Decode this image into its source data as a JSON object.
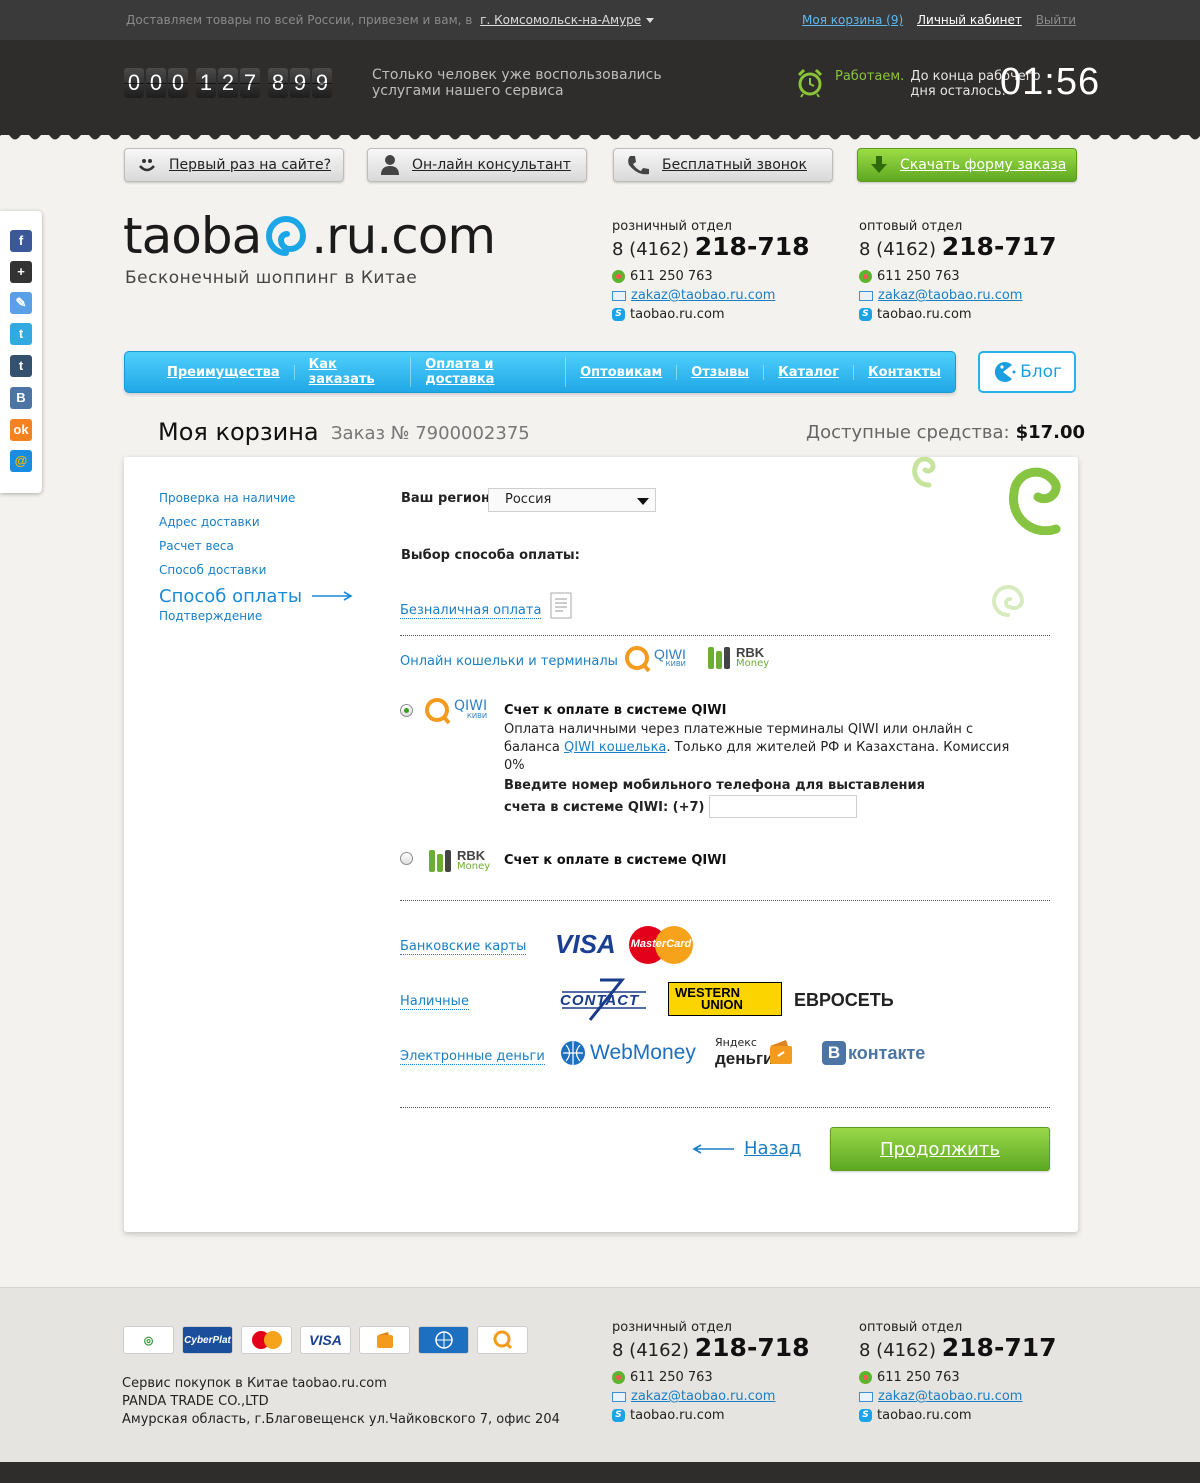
{
  "topbar": {
    "delivery_text": "Доставляем товары по всей России, привезем и вам, в",
    "city": "г. Комсомольск-на-Амуре",
    "cart_link": "Моя корзина (9)",
    "cabinet_link": "Личный кабинет",
    "exit_link": "Выйти"
  },
  "header": {
    "counter_groups": [
      "000",
      "127",
      "899"
    ],
    "counter_text": "Столько человек уже воспользовались услугами нашего сервиса",
    "work_status": "Работаем.",
    "work_text": "До конца рабочего дня осталось:",
    "timer": "01:56"
  },
  "buttons": {
    "first_time": "Первый раз на сайте?",
    "consultant": "Он-лайн консультант",
    "free_call": "Бесплатный звонок",
    "download_form": "Скачать форму заказа"
  },
  "logo": {
    "text_left": "taoba",
    "text_right": ".ru.com",
    "slogan": "Бесконечный шоппинг в Китае"
  },
  "contacts": [
    {
      "dept": "розничный отдел",
      "phone_code": "8 (4162)",
      "phone_number": "218-718",
      "icq": "611 250 763",
      "email": "zakaz@taobao.ru.com",
      "skype": "taobao.ru.com"
    },
    {
      "dept": "оптовый отдел",
      "phone_code": "8 (4162)",
      "phone_number": "218-717",
      "icq": "611 250 763",
      "email": "zakaz@taobao.ru.com",
      "skype": "taobao.ru.com"
    }
  ],
  "nav": {
    "items": [
      "Преимущества",
      "Как заказать",
      "Оплата и доставка",
      "Оптовикам",
      "Отзывы",
      "Каталог",
      "Контакты"
    ],
    "blog": "Блог"
  },
  "cart": {
    "title": "Моя корзина",
    "order_no": "Заказ № 7900002375",
    "funds_label": "Доступные средства:",
    "funds_value": "$17.00"
  },
  "steps": {
    "items": [
      "Проверка на наличие",
      "Адрес доставки",
      "Расчет веса",
      "Способ доставки"
    ],
    "active": "Способ оплаты",
    "last": "Подтверждение"
  },
  "form": {
    "region_label": "Ваш регион:",
    "region_value": "Россия",
    "choose_label": "Выбор способа оплаты:",
    "cashless": "Безналичная оплата",
    "online_wallets": "Онлайн кошельки и терминалы",
    "qiwi_option_title": "Счет к оплате в системе QIWI",
    "qiwi_desc_1": "Оплата наличными через платежные терминалы QIWI или онлайн с баланса",
    "qiwi_desc_link": "QIWI кошелька",
    "qiwi_desc_2": ". Только для жителей РФ и Казахстана. Комиссия 0%",
    "phone_prompt_1": "Введите номер мобильного телефона для выставления",
    "phone_prompt_2": "счета в системе QIWI: (+7)",
    "rbk_option_title": "Счет к оплате в системе QIWI",
    "bank_cards": "Банковские карты",
    "cash": "Наличные",
    "emoney": "Электронные деньги",
    "back": "Назад",
    "continue": "Продолжить"
  },
  "logos": {
    "qiwi": "QIWI",
    "qiwi_sub": "КИВИ",
    "rbk": "RBK",
    "rbk_sub": "Money",
    "visa": "VISA",
    "mastercard": "MasterCard",
    "contact": "CONTACT",
    "western_union_1": "WESTERN",
    "western_union_2": "UNION",
    "euroset": "ЕВРОСЕТЬ",
    "webmoney": "WebMoney",
    "yandex_1": "Яндекс",
    "yandex_2": "деньги",
    "vkontakte": "контакте"
  },
  "footer": {
    "pay_icons": [
      "Сбербанк",
      "CyberPlat",
      "MasterCard",
      "VISA",
      "Яндекс",
      "WebMoney",
      "QIWI"
    ],
    "line1": "Сервис покупок в Китае taobao.ru.com",
    "line2": "PANDA TRADE CO.,LTD",
    "line3": "Амурская область, г.Благовещенск ул.Чайковского 7, офис 204"
  },
  "colors": {
    "accent_blue": "#20a8e6",
    "accent_green": "#7cc232",
    "dark_header": "#2f2d2b"
  },
  "social": [
    "facebook-icon",
    "google-plus-icon",
    "bookmark-icon",
    "twitter-icon",
    "tumblr-icon",
    "vkontakte-icon",
    "odnoklassniki-icon",
    "mailru-icon"
  ]
}
